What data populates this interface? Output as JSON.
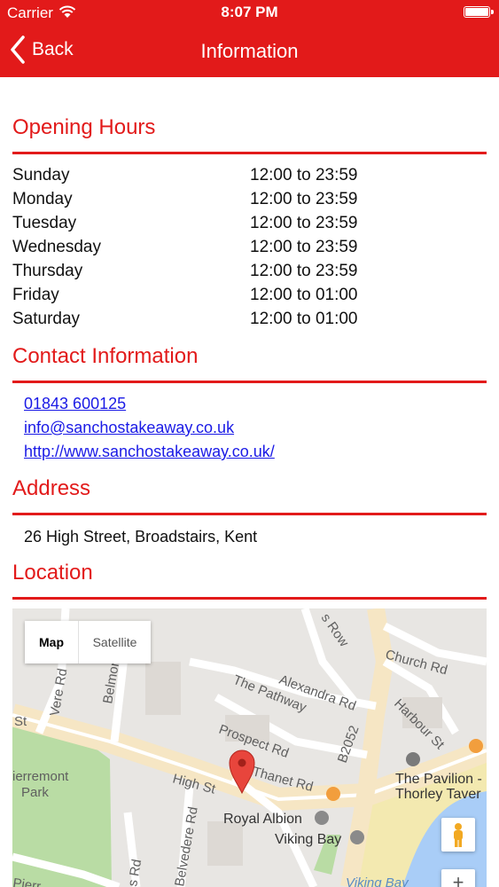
{
  "status_bar": {
    "carrier": "Carrier",
    "time": "8:07 PM"
  },
  "nav": {
    "back_label": "Back",
    "title": "Information"
  },
  "opening_hours": {
    "heading": "Opening Hours",
    "rows": [
      {
        "day": "Sunday",
        "hours": "12:00 to 23:59"
      },
      {
        "day": "Monday",
        "hours": "12:00 to 23:59"
      },
      {
        "day": "Tuesday",
        "hours": "12:00 to 23:59"
      },
      {
        "day": "Wednesday",
        "hours": "12:00 to 23:59"
      },
      {
        "day": "Thursday",
        "hours": "12:00 to 23:59"
      },
      {
        "day": "Friday",
        "hours": "12:00 to 01:00"
      },
      {
        "day": "Saturday",
        "hours": "12:00 to 01:00"
      }
    ]
  },
  "contact": {
    "heading": "Contact Information",
    "phone": "01843 600125",
    "email": "info@sanchostakeaway.co.uk",
    "website": "http://www.sanchostakeaway.co.uk/"
  },
  "address": {
    "heading": "Address",
    "text": "26 High Street, Broadstairs, Kent"
  },
  "location": {
    "heading": "Location",
    "map": {
      "map_button": "Map",
      "satellite_button": "Satellite",
      "labels": {
        "vere_rd": "Vere Rd",
        "belmont": "Belmont",
        "s_row": "s Row",
        "church_rd": "Church Rd",
        "the_pathway": "The Pathway",
        "alexandra_rd": "Alexandra Rd",
        "harbour_st": "Harbour St",
        "prospect_rd": "Prospect Rd",
        "b2052": "B2052",
        "pierremont_park_1": "ierremont",
        "pierremont_park_2": "Park",
        "high_st": "High St",
        "thanet_rd": "Thanet Rd",
        "the_pavilion_1": "The Pavilion -",
        "the_pavilion_2": "Thorley Taver",
        "st": "St",
        "royal_albion": "Royal Albion",
        "viking_bay": "Viking Bay",
        "belvedere_rd": "Belvedere Rd",
        "s_rd": "s Rd",
        "pierr": "Pierr",
        "viking_bay_water": "Viking Bay"
      },
      "zoom_in": "+"
    }
  },
  "colors": {
    "accent": "#e21a1a",
    "link": "#1a1ae6"
  }
}
